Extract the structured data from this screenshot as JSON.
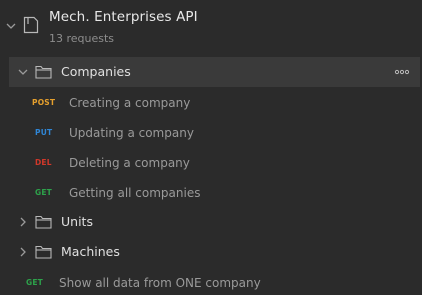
{
  "collection": {
    "name": "Mech. Enterprises API",
    "count": "13 requests"
  },
  "folders": [
    {
      "label": "Companies",
      "expanded": true,
      "selected": true
    },
    {
      "label": "Units",
      "expanded": false
    },
    {
      "label": "Machines",
      "expanded": false
    }
  ],
  "requests": [
    {
      "method": "POST",
      "label": "Creating a company"
    },
    {
      "method": "PUT",
      "label": "Updating a company"
    },
    {
      "method": "DEL",
      "label": "Deleting a company"
    },
    {
      "method": "GET",
      "label": "Getting all companies"
    }
  ],
  "root_requests": [
    {
      "method": "GET",
      "label": "Show all data from ONE company"
    }
  ],
  "colors": {
    "background": "#2b2b2b",
    "selected_row": "#3a3a3a",
    "post": "#e6a02d",
    "put": "#2f86d6",
    "delete": "#d2382a",
    "get": "#2da34b"
  }
}
